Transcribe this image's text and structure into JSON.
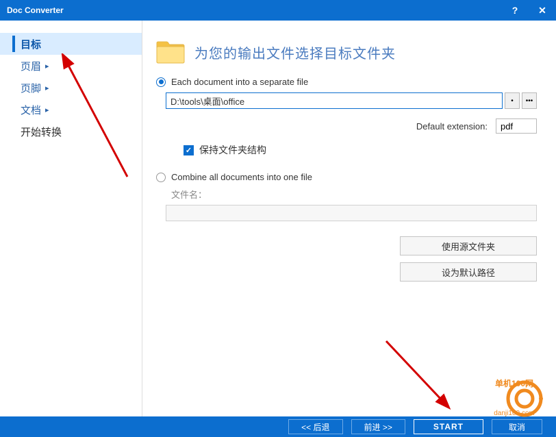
{
  "titlebar": {
    "title": "Doc Converter"
  },
  "sidebar": {
    "items": [
      {
        "label": "目标",
        "selected": true,
        "arrow": false,
        "plain": false
      },
      {
        "label": "页眉",
        "selected": false,
        "arrow": true,
        "plain": false
      },
      {
        "label": "页脚",
        "selected": false,
        "arrow": true,
        "plain": false
      },
      {
        "label": "文档",
        "selected": false,
        "arrow": true,
        "plain": false
      },
      {
        "label": "开始转换",
        "selected": false,
        "arrow": false,
        "plain": true
      }
    ]
  },
  "main": {
    "header_title": "为您的输出文件选择目标文件夹",
    "radio_separate": "Each document into a separate file",
    "path_value": "D:\\tools\\桌面\\office",
    "ext_label": "Default extension:",
    "ext_value": "pdf",
    "keep_structure": "保持文件夹结构",
    "radio_combine": "Combine all documents into one file",
    "filename_label": "文件名：",
    "use_source_btn": "使用源文件夹",
    "set_default_btn": "设为默认路径"
  },
  "footer": {
    "back": "<<  后退",
    "forward": "前进  >>",
    "start": "START",
    "cancel": "取消"
  },
  "watermark": {
    "line1": "单机100网",
    "line2": "danji100.com"
  }
}
